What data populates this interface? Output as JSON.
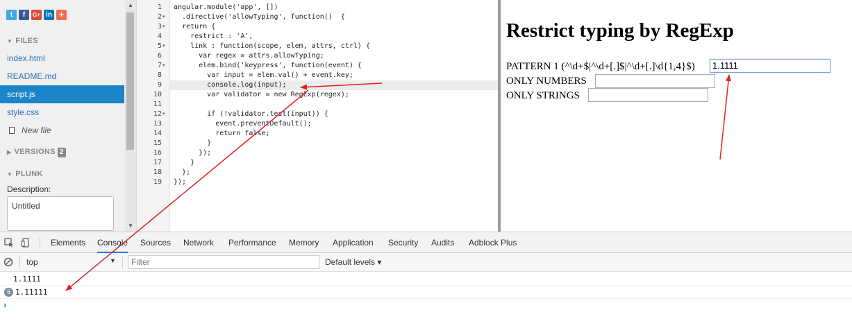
{
  "sidebar": {
    "social": [
      {
        "name": "twitter-icon",
        "glyph": "t"
      },
      {
        "name": "facebook-icon",
        "glyph": "f"
      },
      {
        "name": "google-plus-icon",
        "glyph": "G+"
      },
      {
        "name": "linkedin-icon",
        "glyph": "in"
      },
      {
        "name": "add-share-icon",
        "glyph": "+"
      }
    ],
    "files_heading": "FILES",
    "files": [
      "index.html",
      "README.md",
      "script.js",
      "style.css"
    ],
    "active_file": "script.js",
    "new_file_label": "New file",
    "versions_heading": "VERSIONS",
    "versions_count": "2",
    "plunk_heading": "PLUNK",
    "description_label": "Description:",
    "description_value": "Untitled"
  },
  "editor": {
    "active_line": 9,
    "lines": [
      "angular.module('app', [])",
      "  .directive('allowTyping', function()  {",
      "  return {",
      "    restrict : 'A',",
      "    link : function(scope, elem, attrs, ctrl) {",
      "      var regex = attrs.allowTyping;",
      "      elem.bind('keypress', function(event) {",
      "        var input = elem.val() + event.key;",
      "        console.log(input);",
      "        var validator = new RegExp(regex);",
      "",
      "        if (!validator.test(input)) {",
      "          event.preventDefault();",
      "          return false;",
      "        }",
      "      });",
      "    }",
      "  };",
      "});"
    ],
    "foldable_lines": [
      2,
      3,
      5,
      7,
      12
    ]
  },
  "preview": {
    "title": "Restrict typing by RegExp",
    "pattern_label": "PATTERN 1 (^\\d+$|^\\d+[.]$|^\\d+[.]\\d{1,4}$)",
    "pattern_value": "1.1111",
    "numbers_label": "ONLY NUMBERS",
    "numbers_value": "",
    "strings_label": "ONLY STRINGS",
    "strings_value": ""
  },
  "devtools": {
    "tabs": [
      "Elements",
      "Console",
      "Sources",
      "Network",
      "Performance",
      "Memory",
      "Application",
      "Security",
      "Audits",
      "Adblock Plus"
    ],
    "active_tab": "Console",
    "context": "top",
    "filter_placeholder": "Filter",
    "levels_label": "Default levels ▾",
    "console_rows": [
      {
        "count": "",
        "text": "1.1111"
      },
      {
        "count": "6",
        "text": "1.11111"
      }
    ],
    "prompt": "›"
  },
  "colors": {
    "active_file_bg": "#1a85c7",
    "annotation_arrow": "#e02020",
    "active_tab_underline": "#1a73e8"
  }
}
